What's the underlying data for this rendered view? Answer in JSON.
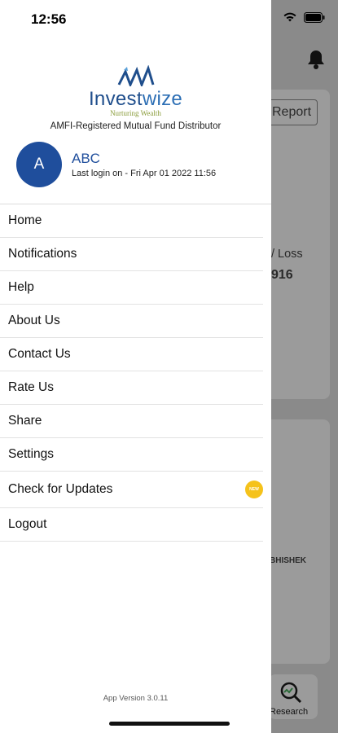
{
  "status": {
    "time": "12:56"
  },
  "brand": {
    "logo_part1": "Invest",
    "logo_part2": "wize",
    "tagline": "Nurturing Wealth",
    "distributor_text": "AMFI-Registered Mutual Fund Distributor",
    "color": "#1f4e8c"
  },
  "user": {
    "avatar_letter": "A",
    "name": "ABC",
    "last_login": "Last login on - Fri Apr 01 2022 11:56"
  },
  "menu": {
    "items": [
      {
        "label": "Home"
      },
      {
        "label": "Notifications"
      },
      {
        "label": "Help"
      },
      {
        "label": "About Us"
      },
      {
        "label": "Contact Us"
      },
      {
        "label": "Rate Us"
      },
      {
        "label": "Share"
      },
      {
        "label": "Settings"
      },
      {
        "label": "Check for Updates",
        "badge": "NEW"
      },
      {
        "label": "Logout"
      }
    ]
  },
  "footer": {
    "app_version": "App Version 3.0.11"
  },
  "background": {
    "report_button": "Report",
    "profit_loss_label": "/ Loss",
    "profit_loss_value": "916",
    "name_fragment": "BHISHEK",
    "research_label": "Research"
  }
}
